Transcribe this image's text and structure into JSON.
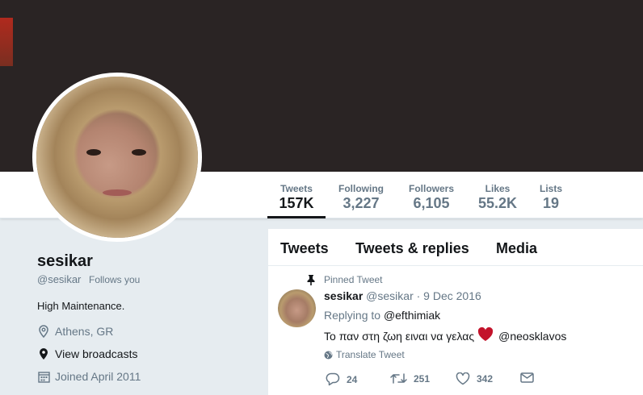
{
  "stats": [
    {
      "label": "Tweets",
      "value": "157K",
      "active": true
    },
    {
      "label": "Following",
      "value": "3,227"
    },
    {
      "label": "Followers",
      "value": "6,105"
    },
    {
      "label": "Likes",
      "value": "55.2K"
    },
    {
      "label": "Lists",
      "value": "19"
    }
  ],
  "profile": {
    "name": "sesikar",
    "handle": "@sesikar",
    "follows_you": "Follows you",
    "bio": "High Maintenance.",
    "location": "Athens, GR",
    "broadcasts": "View broadcasts",
    "joined": "Joined April 2011"
  },
  "tabs": [
    "Tweets",
    "Tweets & replies",
    "Media"
  ],
  "tweet": {
    "pinned_label": "Pinned Tweet",
    "name": "sesikar",
    "handle_date": "@sesikar · 9 Dec 2016",
    "replying_prefix": "Replying to",
    "replying_to": "@efthimiak",
    "text": "Το παν στη ζωη ειναι να γελας",
    "mention": "@neosklavos",
    "translate": "Translate Tweet",
    "replies": "24",
    "retweets": "251",
    "likes": "342"
  },
  "colors": {
    "banner": "#2a2424",
    "heart": "#e0245e",
    "secondary_text": "#657786"
  }
}
